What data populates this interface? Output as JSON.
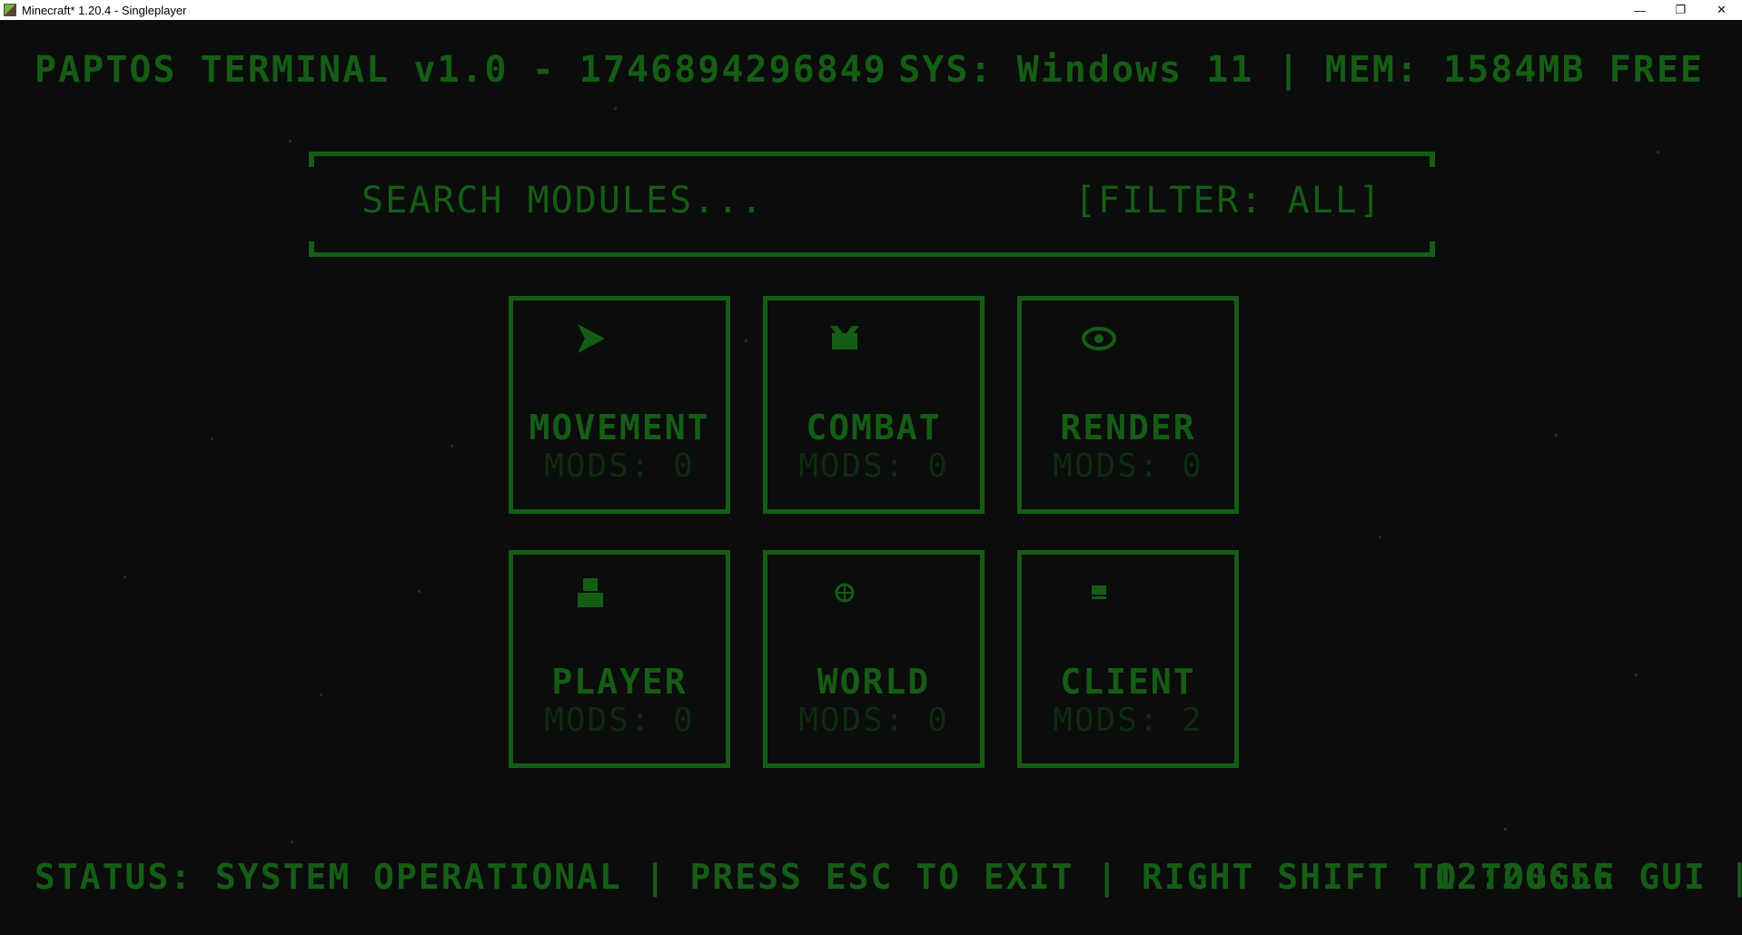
{
  "window": {
    "title": "Minecraft* 1.20.4 - Singleplayer",
    "minimize": "—",
    "maximize": "❐",
    "close": "✕"
  },
  "header": {
    "title": "PAPTOS TERMINAL v1.0 - 1746894296849",
    "system_info": "SYS: Windows 11 | MEM: 1584MB FREE"
  },
  "search": {
    "placeholder": "SEARCH MODULES...",
    "filter": "[FILTER: ALL]"
  },
  "categories": [
    {
      "name": "MOVEMENT",
      "mods": "MODS: 0",
      "icon": "arrow-icon"
    },
    {
      "name": "COMBAT",
      "mods": "MODS: 0",
      "icon": "sword-icon"
    },
    {
      "name": "RENDER",
      "mods": "MODS: 0",
      "icon": "eye-icon"
    },
    {
      "name": "PLAYER",
      "mods": "MODS: 0",
      "icon": "person-icon"
    },
    {
      "name": "WORLD",
      "mods": "MODS: 0",
      "icon": "globe-icon"
    },
    {
      "name": "CLIENT",
      "mods": "MODS: 2",
      "icon": "monitor-icon"
    }
  ],
  "status": {
    "text": "STATUS: SYSTEM OPERATIONAL | PRESS ESC TO EXIT | RIGHT SHIFT TO TOGGLE GUI | SHIFT+CLICK",
    "clock": "12:20:56"
  },
  "colors": {
    "accent": "#155d15",
    "dim": "#0f2b10",
    "background": "#0b0c0c"
  }
}
